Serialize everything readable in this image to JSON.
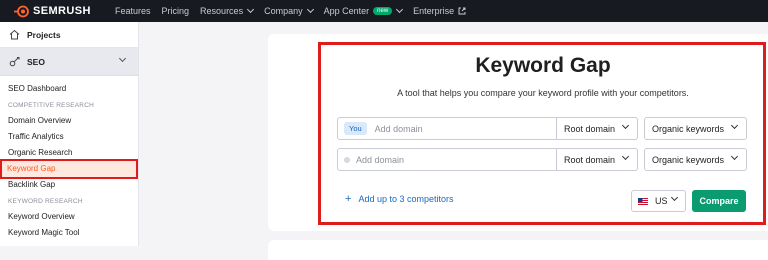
{
  "brand": {
    "name": "SEMRUSH",
    "accent": "#ff642d"
  },
  "topnav": {
    "items": [
      {
        "label": "Features",
        "dropdown": false
      },
      {
        "label": "Pricing",
        "dropdown": false
      },
      {
        "label": "Resources",
        "dropdown": true
      },
      {
        "label": "Company",
        "dropdown": true
      },
      {
        "label": "App Center",
        "dropdown": true,
        "badge": "new"
      },
      {
        "label": "Enterprise",
        "external": true
      }
    ]
  },
  "sidebar": {
    "projects_label": "Projects",
    "seo_label": "SEO",
    "dashboard_label": "SEO Dashboard",
    "competitive_section": "COMPETITIVE RESEARCH",
    "competitive_items": [
      "Domain Overview",
      "Traffic Analytics",
      "Organic Research",
      "Keyword Gap",
      "Backlink Gap"
    ],
    "active_item": "Keyword Gap",
    "keyword_section": "KEYWORD RESEARCH",
    "keyword_items": [
      "Keyword Overview",
      "Keyword Magic Tool"
    ]
  },
  "main": {
    "title": "Keyword Gap",
    "subtitle": "A tool that helps you compare your keyword profile with your competitors.",
    "rows": [
      {
        "chip": "You",
        "placeholder": "Add domain",
        "scope": "Root domain",
        "type": "Organic keywords"
      },
      {
        "chip": "",
        "placeholder": "Add domain",
        "scope": "Root domain",
        "type": "Organic keywords"
      }
    ],
    "add_competitors": "Add up to 3 competitors",
    "country": "US",
    "compare_label": "Compare"
  },
  "colors": {
    "highlight": "#e01b1b",
    "compare_button": "#0b9b71",
    "link": "#1c69c4"
  }
}
